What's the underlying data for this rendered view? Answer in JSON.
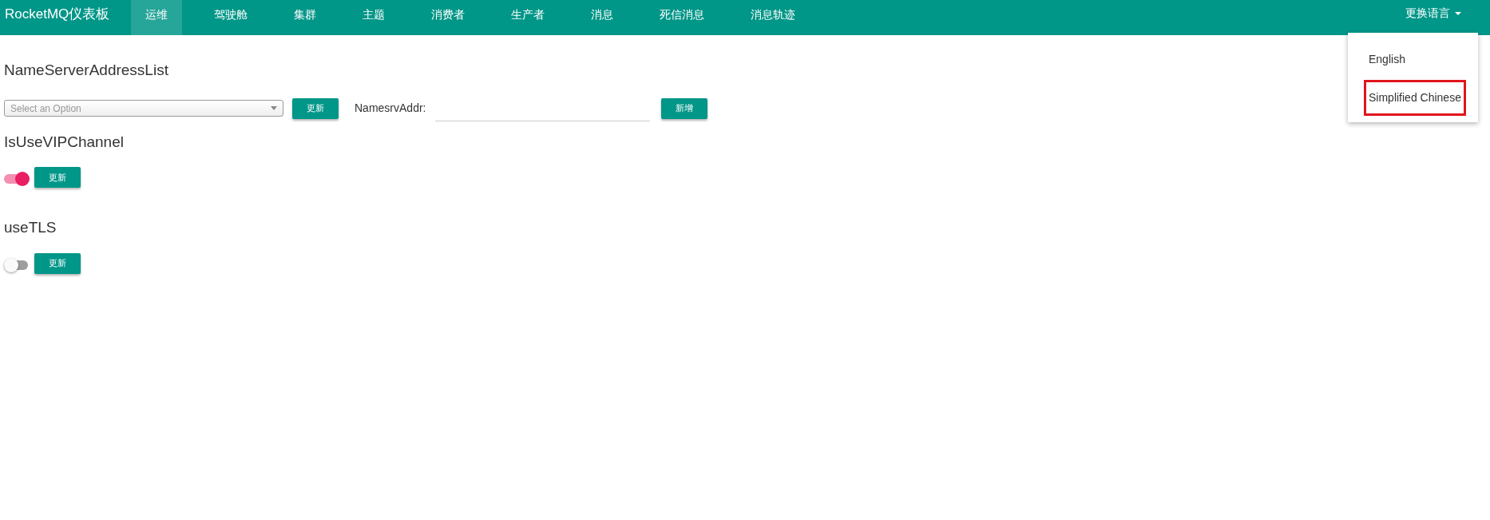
{
  "navbar": {
    "brand": "RocketMQ仪表板",
    "items": [
      {
        "label": "运维",
        "selected": true
      },
      {
        "label": "驾驶舱",
        "selected": false
      },
      {
        "label": "集群",
        "selected": false
      },
      {
        "label": "主题",
        "selected": false
      },
      {
        "label": "消费者",
        "selected": false
      },
      {
        "label": "生产者",
        "selected": false
      },
      {
        "label": "消息",
        "selected": false
      },
      {
        "label": "死信消息",
        "selected": false
      },
      {
        "label": "消息轨迹",
        "selected": false
      }
    ],
    "language": {
      "label": "更换语言",
      "expanded": true,
      "options": [
        {
          "label": "English",
          "selected": false
        },
        {
          "label": "Simplified Chinese",
          "selected": true
        }
      ]
    }
  },
  "nameserver": {
    "title": "NameServerAddressList",
    "select": {
      "placeholder": "Select an Option"
    },
    "update_button": "更新",
    "addr_label": "NamesrvAddr:",
    "add_button": "新增"
  },
  "settings": [
    {
      "title": "IsUseVIPChannel",
      "on": true,
      "button": "更新"
    },
    {
      "title": "useTLS",
      "on": false,
      "button": "更新"
    }
  ]
}
